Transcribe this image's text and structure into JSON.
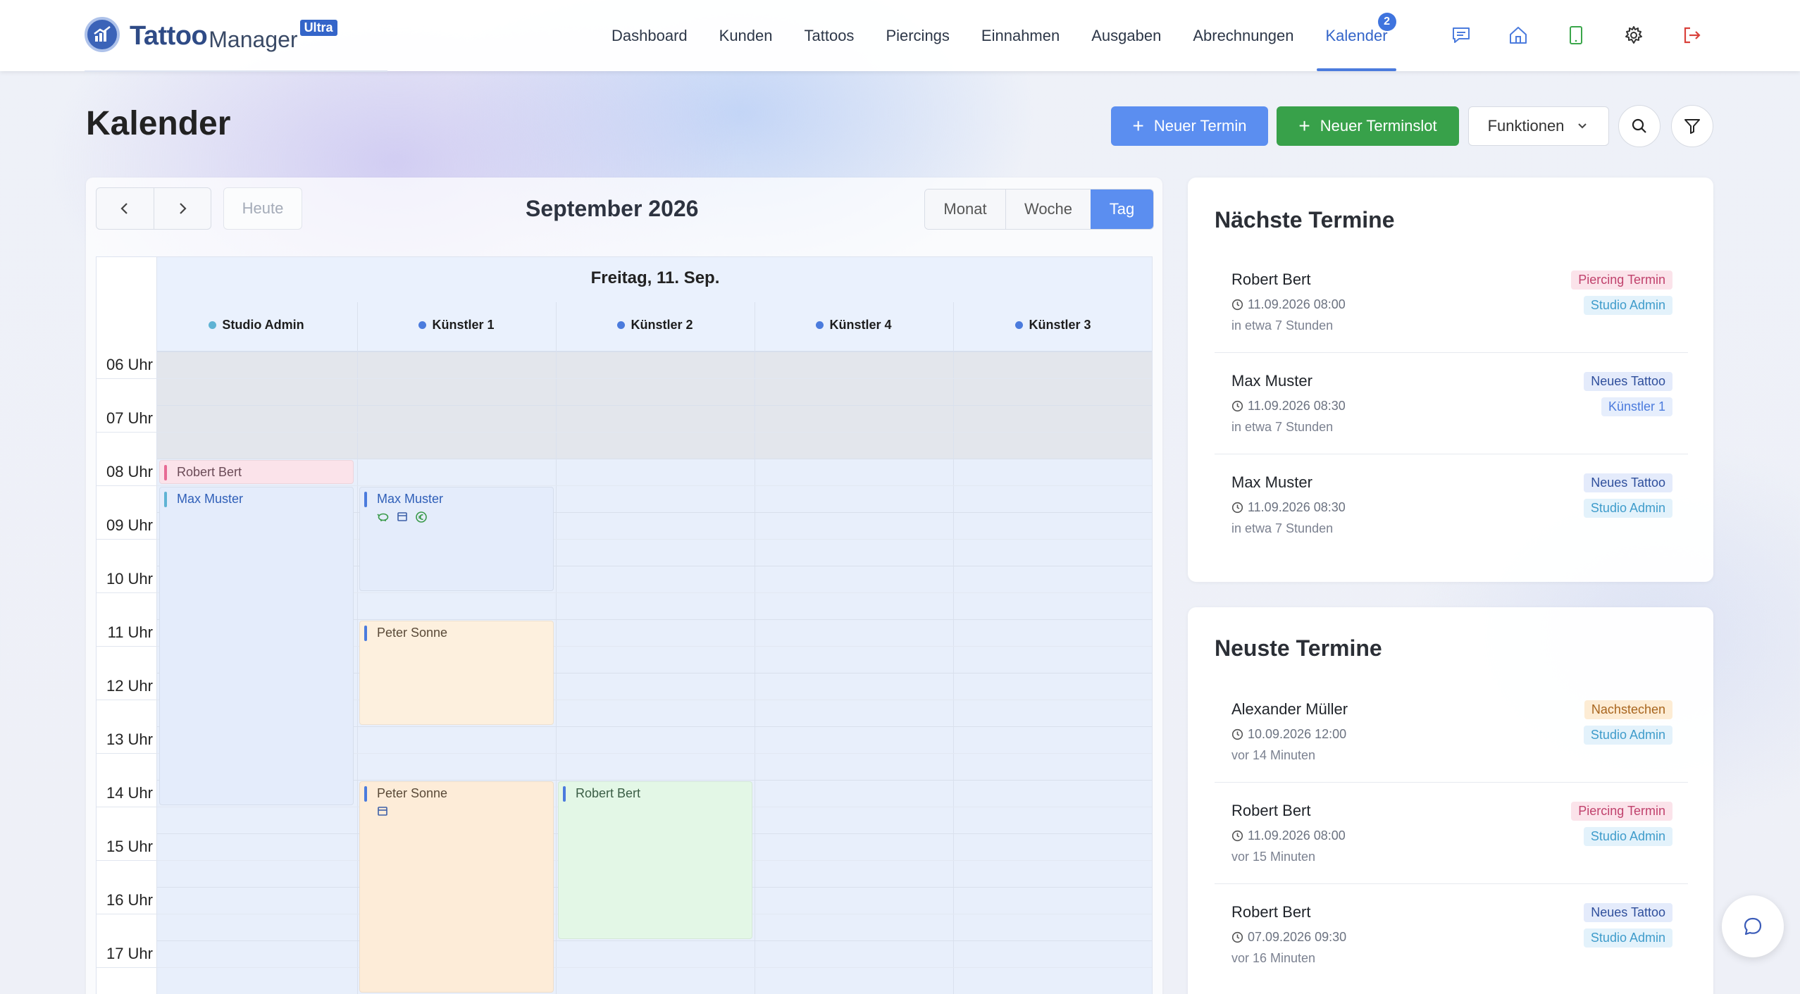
{
  "app": {
    "brand_part1": "Tattoo",
    "brand_part2": "Manager",
    "brand_edition": "Ultra"
  },
  "nav": {
    "items": [
      {
        "label": "Dashboard"
      },
      {
        "label": "Kunden"
      },
      {
        "label": "Tattoos"
      },
      {
        "label": "Piercings"
      },
      {
        "label": "Einnahmen"
      },
      {
        "label": "Ausgaben"
      },
      {
        "label": "Abrechnungen"
      },
      {
        "label": "Kalender",
        "active": true,
        "badge": "2"
      }
    ],
    "icons": [
      "chat-icon",
      "home-icon",
      "tablet-icon",
      "gear-icon",
      "logout-icon"
    ]
  },
  "header": {
    "title": "Kalender",
    "new_appointment": "Neuer Termin",
    "new_slot": "Neuer Terminslot",
    "functions": "Funktionen"
  },
  "calendar": {
    "today": "Heute",
    "month_title": "September 2026",
    "views": {
      "month": "Monat",
      "week": "Woche",
      "day": "Tag"
    },
    "active_view": "Tag",
    "date_heading": "Freitag, 11. Sep.",
    "resources": [
      {
        "name": "Studio Admin",
        "color": "#5fb3d4"
      },
      {
        "name": "Künstler 1",
        "color": "#4b7bdd"
      },
      {
        "name": "Künstler 2",
        "color": "#4b7bdd"
      },
      {
        "name": "Künstler 4",
        "color": "#4b7bdd"
      },
      {
        "name": "Künstler 3",
        "color": "#4b7bdd"
      }
    ],
    "hours": [
      "06 Uhr",
      "07 Uhr",
      "08 Uhr",
      "09 Uhr",
      "10 Uhr",
      "11 Uhr",
      "12 Uhr",
      "13 Uhr",
      "14 Uhr",
      "15 Uhr",
      "16 Uhr",
      "17 Uhr"
    ],
    "events": [
      {
        "title": "Robert Bert",
        "resource": "Studio Admin",
        "start": "08:00",
        "end": "08:30",
        "color": "#fbe3ea",
        "accent": "#e76b94",
        "text": "#6b4b57"
      },
      {
        "title": "Max Muster",
        "resource": "Studio Admin",
        "start": "08:30",
        "end": "14:30",
        "color": "#e4ecfb",
        "accent": "#5fb3d4",
        "text": "#2f5fb8"
      },
      {
        "title": "Max Muster",
        "resource": "Künstler 1",
        "start": "08:30",
        "end": "10:30",
        "color": "#e4ecfb",
        "accent": "#4b7bdd",
        "text": "#2f5fb8",
        "icons": [
          "piggy-bank-icon",
          "calendar-icon",
          "euro-icon"
        ]
      },
      {
        "title": "Peter Sonne",
        "resource": "Künstler 1",
        "start": "11:00",
        "end": "13:00",
        "color": "#fdf0de",
        "accent": "#4b7bdd",
        "text": "#5a4a38"
      },
      {
        "title": "Peter Sonne",
        "resource": "Künstler 1",
        "start": "14:00",
        "end": "18:00",
        "color": "#fdecd8",
        "accent": "#4b7bdd",
        "text": "#5a4a38",
        "icons": [
          "calendar-icon"
        ]
      },
      {
        "title": "Robert Bert",
        "resource": "Künstler 2",
        "start": "14:00",
        "end": "17:00",
        "color": "#e3f7e6",
        "accent": "#4b7bdd",
        "text": "#3b5e46"
      }
    ]
  },
  "next_appointments": {
    "title": "Nächste Termine",
    "items": [
      {
        "name": "Robert Bert",
        "datetime": "11.09.2026 08:00",
        "relative": "in etwa 7 Stunden",
        "type": "Piercing Termin",
        "type_bg": "#fbe3ea",
        "type_fg": "#c0416c",
        "artist": "Studio Admin",
        "artist_bg": "#e3f2fb",
        "artist_fg": "#3f9ccb"
      },
      {
        "name": "Max Muster",
        "datetime": "11.09.2026 08:30",
        "relative": "in etwa 7 Stunden",
        "type": "Neues Tattoo",
        "type_bg": "#e4ebfb",
        "type_fg": "#2f4f9c",
        "artist": "Künstler 1",
        "artist_bg": "#e6eefc",
        "artist_fg": "#4b7bdd"
      },
      {
        "name": "Max Muster",
        "datetime": "11.09.2026 08:30",
        "relative": "in etwa 7 Stunden",
        "type": "Neues Tattoo",
        "type_bg": "#e4ebfb",
        "type_fg": "#2f4f9c",
        "artist": "Studio Admin",
        "artist_bg": "#e3f2fb",
        "artist_fg": "#3f9ccb"
      }
    ]
  },
  "latest_appointments": {
    "title": "Neuste Termine",
    "items": [
      {
        "name": "Alexander Müller",
        "datetime": "10.09.2026 12:00",
        "relative": "vor 14 Minuten",
        "type": "Nachstechen",
        "type_bg": "#fdecd4",
        "type_fg": "#a8651e",
        "artist": "Studio Admin",
        "artist_bg": "#e3f2fb",
        "artist_fg": "#3f9ccb"
      },
      {
        "name": "Robert Bert",
        "datetime": "11.09.2026 08:00",
        "relative": "vor 15 Minuten",
        "type": "Piercing Termin",
        "type_bg": "#fbe3ea",
        "type_fg": "#c0416c",
        "artist": "Studio Admin",
        "artist_bg": "#e3f2fb",
        "artist_fg": "#3f9ccb"
      },
      {
        "name": "Robert Bert",
        "datetime": "07.09.2026 09:30",
        "relative": "vor 16 Minuten",
        "type": "Neues Tattoo",
        "type_bg": "#e4ebfb",
        "type_fg": "#2f4f9c",
        "artist": "Studio Admin",
        "artist_bg": "#e3f2fb",
        "artist_fg": "#3f9ccb"
      }
    ]
  }
}
